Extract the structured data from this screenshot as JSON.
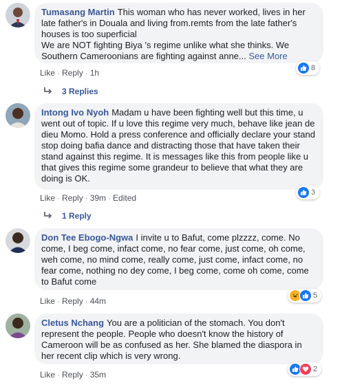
{
  "comments": [
    {
      "name": "Tumasang Martin",
      "text": "This woman who has never worked, lives in her late father's in Douala and living from.remts from the late father's houses is too superficial",
      "text2": "We are NOT fighting Biya 's regime unlike what she thinks. We Southern Cameroonians are fighting against anne...",
      "see_more": "See More",
      "like": "Like",
      "reply": "Reply",
      "time": "1h",
      "reaction_count": "8",
      "replies_label": "3 Replies"
    },
    {
      "name": "Intong Ivo Nyoh",
      "text": "Madam u have been fighting well but this time, u went out of topic. If u love this regime very much, behave like jean de dieu Momo. Hold a press conference and officially declare your stand stop doing bafia dance and distracting those that have taken their stand against this regime. It is messages like this from people like u that gives this regime some grandeur to believe that what they are doing is OK.",
      "like": "Like",
      "reply": "Reply",
      "time": "39m",
      "edited": "Edited",
      "reaction_count": "3",
      "replies_label": "1 Reply"
    },
    {
      "name": "Don Tee Ebogo-Ngwa",
      "text": "I invite u to Bafut, come plzzzz, come. No come, I beg come, infact come, no fear come, just come, oh come, weh come, no mind come, really come, just come, infact come, no fear come, nothing no dey come, I beg come, come oh come, come to Bafut come",
      "like": "Like",
      "reply": "Reply",
      "time": "44m",
      "reaction_count": "5"
    },
    {
      "name": "Cletus Nchang",
      "text": "You are a politician of the stomach. You don't represent the people. People who doesn't know the history of Cameroon will be as confused as her. She blamed the diaspora in her recent clip which is very wrong.",
      "like": "Like",
      "reply": "Reply",
      "time": "35m",
      "reaction_count": "2"
    }
  ],
  "colors": {
    "link": "#385898",
    "bubble": "#f2f3f5",
    "like_blue": "#1877f2",
    "love_red": "#f33e58",
    "haha_yellow": "#f7b125"
  }
}
